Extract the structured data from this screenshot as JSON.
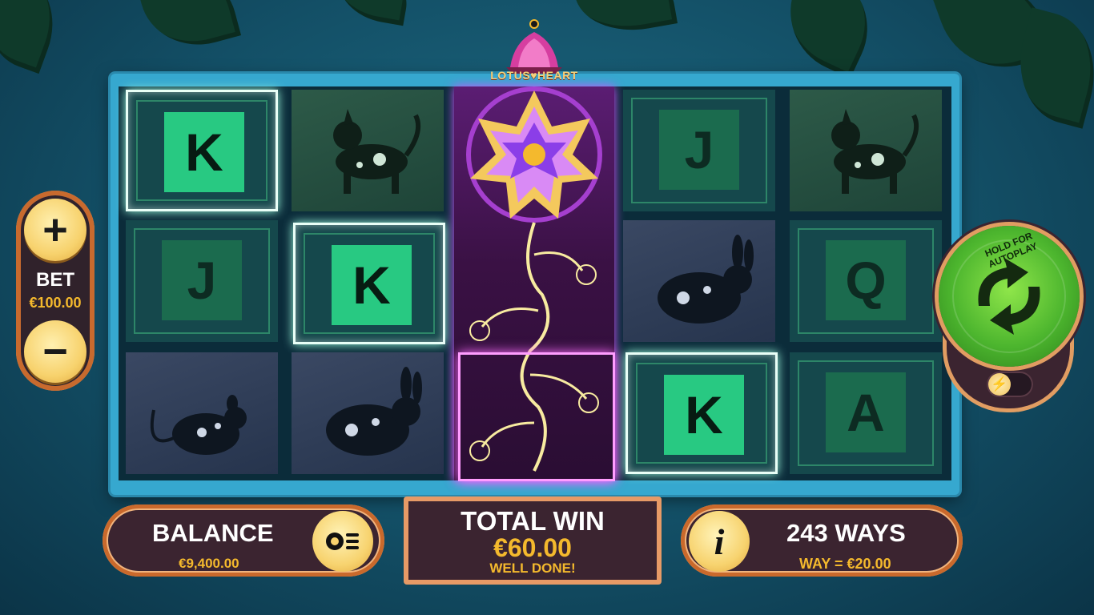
{
  "game": {
    "title": "LOTUS♥HEART"
  },
  "bet": {
    "plus_symbol": "+",
    "label": "BET",
    "value": "€100.00",
    "minus_symbol": "−"
  },
  "balance": {
    "label": "BALANCE",
    "value": "€9,400.00"
  },
  "total_win": {
    "label": "TOTAL WIN",
    "value": "€60.00",
    "message": "WELL DONE!"
  },
  "ways": {
    "info_symbol": "i",
    "label": "243 WAYS",
    "way_value": "WAY = €20.00"
  },
  "spin": {
    "label": "HOLD FOR AUTOPLAY"
  },
  "reels": {
    "r1": {
      "s1": "K",
      "s2": "J",
      "s3": "rat"
    },
    "r2": {
      "s1": "dog",
      "s2": "K",
      "s3": "rabbit"
    },
    "r3": {
      "s1": "lotus",
      "s2": "vine",
      "s3": "vine"
    },
    "r4": {
      "s1": "J",
      "s2": "rabbit",
      "s3": "K"
    },
    "r5": {
      "s1": "dog",
      "s2": "Q",
      "s3": "A"
    }
  },
  "colors": {
    "accent_gold": "#f4b92d",
    "frame_blue": "#36a8cf",
    "panel_dark": "#3b2430",
    "spin_green": "#4cb52e"
  }
}
